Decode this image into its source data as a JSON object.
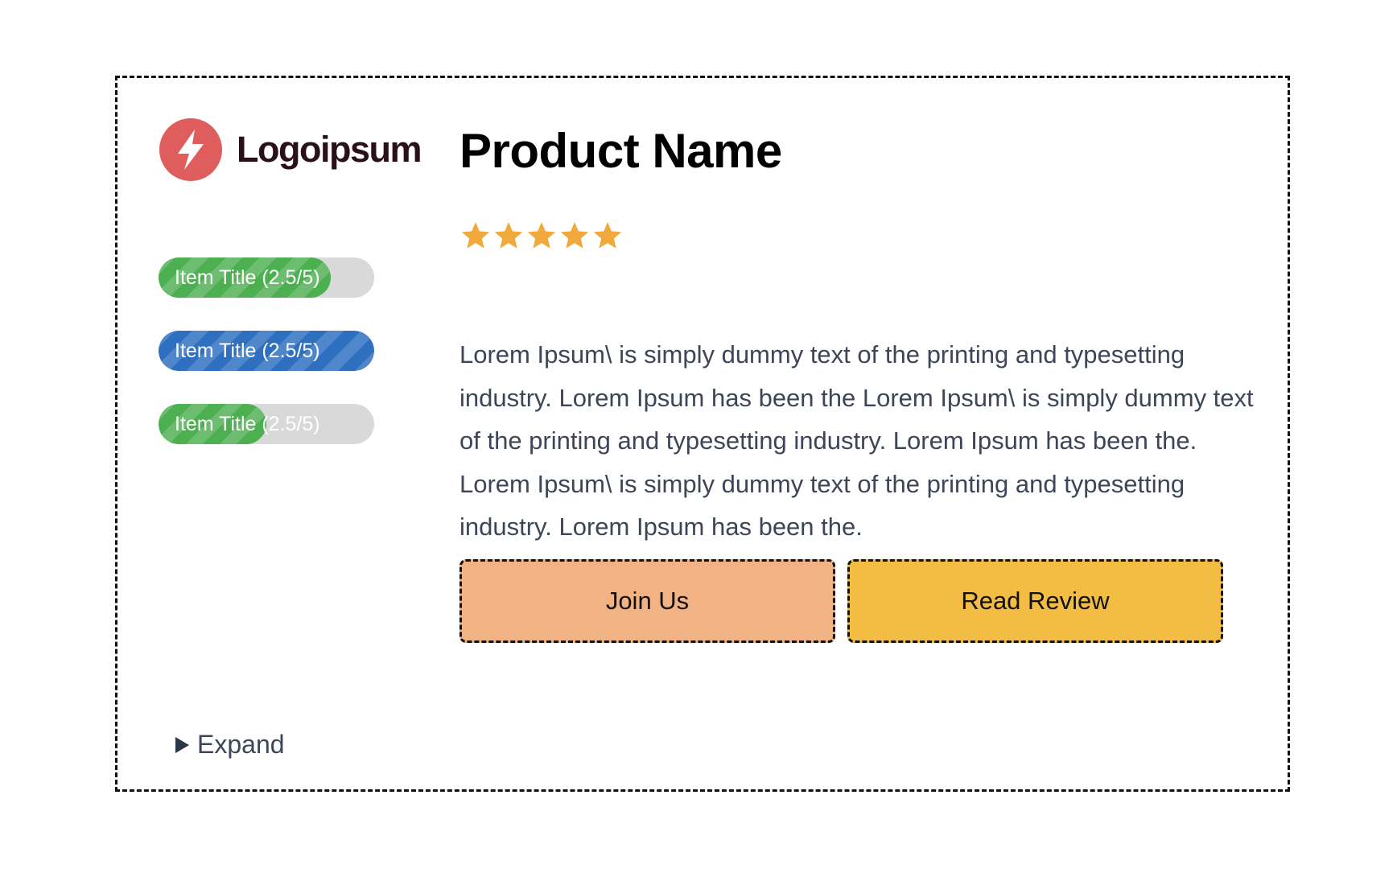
{
  "brand": {
    "name": "Logoipsum",
    "icon": "lightning-bolt-icon",
    "mark_color": "#e05d5d"
  },
  "progress_items": [
    {
      "label": "Item Title (2.5/5)",
      "fill_fraction": 0.8,
      "color": "#4caf50"
    },
    {
      "label": "Item Title (2.5/5)",
      "fill_fraction": 1.0,
      "color": "#2f6fc0"
    },
    {
      "label": "Item Title (2.5/5)",
      "fill_fraction": 0.5,
      "color": "#4caf50"
    }
  ],
  "product": {
    "title": "Product Name",
    "rating": 5,
    "rating_max": 5,
    "star_color": "#f2a93b",
    "description": "Lorem Ipsum\\ is simply dummy text of the printing and typesetting industry. Lorem Ipsum has been the Lorem Ipsum\\ is simply dummy text of the printing and typesetting industry. Lorem Ipsum has been the. Lorem Ipsum\\ is simply dummy text of the printing and typesetting industry. Lorem Ipsum has been the."
  },
  "actions": {
    "join_label": "Join Us",
    "join_color": "#f2b384",
    "review_label": "Read Review",
    "review_color": "#f2bd42"
  },
  "expand": {
    "label": "Expand",
    "icon": "triangle-right-icon"
  }
}
